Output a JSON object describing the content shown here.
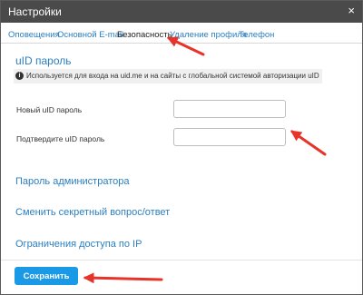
{
  "dialog": {
    "title": "Настройки",
    "close_glyph": "×"
  },
  "tabs": [
    {
      "label": "Оповещения"
    },
    {
      "label": "Основной E-mail"
    },
    {
      "label": "Безопасность"
    },
    {
      "label": "Удаление профиля"
    },
    {
      "label": "Телефон"
    }
  ],
  "active_tab": "Безопасность",
  "uid_section": {
    "title": "uID пароль",
    "info_icon": "info-icon",
    "info_glyph": "i",
    "info_text": "Используется для входа на uid.me и на сайты с глобальной системой авторизации uID",
    "new_password_label": "Новый uID пароль",
    "new_password_value": "",
    "confirm_password_label": "Подтвердите uID пароль",
    "confirm_password_value": ""
  },
  "sections": {
    "admin_password": "Пароль администратора",
    "secret_question": "Сменить секретный вопрос/ответ",
    "ip_restrictions": "Ограничения доступа по IP"
  },
  "footer": {
    "save_label": "Сохранить"
  },
  "annotation_color": "#e8332a",
  "accent_color": "#1a9ae6"
}
